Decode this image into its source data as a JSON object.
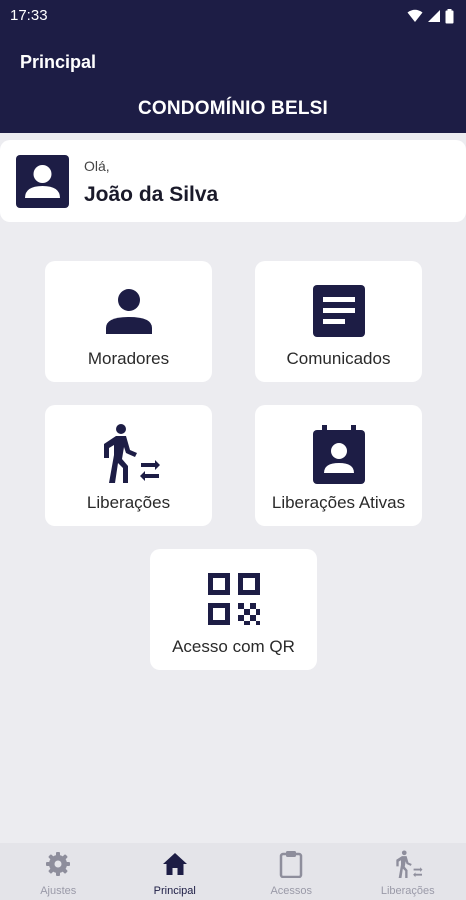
{
  "status_bar": {
    "time": "17:33"
  },
  "header": {
    "title": "Principal",
    "condo_name": "CONDOMÍNIO BELSI"
  },
  "user": {
    "greeting": "Olá,",
    "name": "João da Silva"
  },
  "tiles": [
    {
      "label": "Moradores",
      "icon": "person-icon"
    },
    {
      "label": "Comunicados",
      "icon": "article-icon"
    },
    {
      "label": "Liberações",
      "icon": "walking-person-arrows-icon"
    },
    {
      "label": "Liberações Ativas",
      "icon": "contact-calendar-icon"
    },
    {
      "label": "Acesso com QR",
      "icon": "qr-code-icon"
    }
  ],
  "bottom_nav": [
    {
      "label": "Ajustes",
      "icon": "gear-icon",
      "active": false
    },
    {
      "label": "Principal",
      "icon": "home-icon",
      "active": true
    },
    {
      "label": "Acessos",
      "icon": "clipboard-icon",
      "active": false
    },
    {
      "label": "Liberações",
      "icon": "walking-person-icon",
      "active": false
    }
  ],
  "colors": {
    "primary": "#1d1d45",
    "background": "#ececf0",
    "card": "#ffffff",
    "nav_inactive": "#9a9aa8"
  }
}
